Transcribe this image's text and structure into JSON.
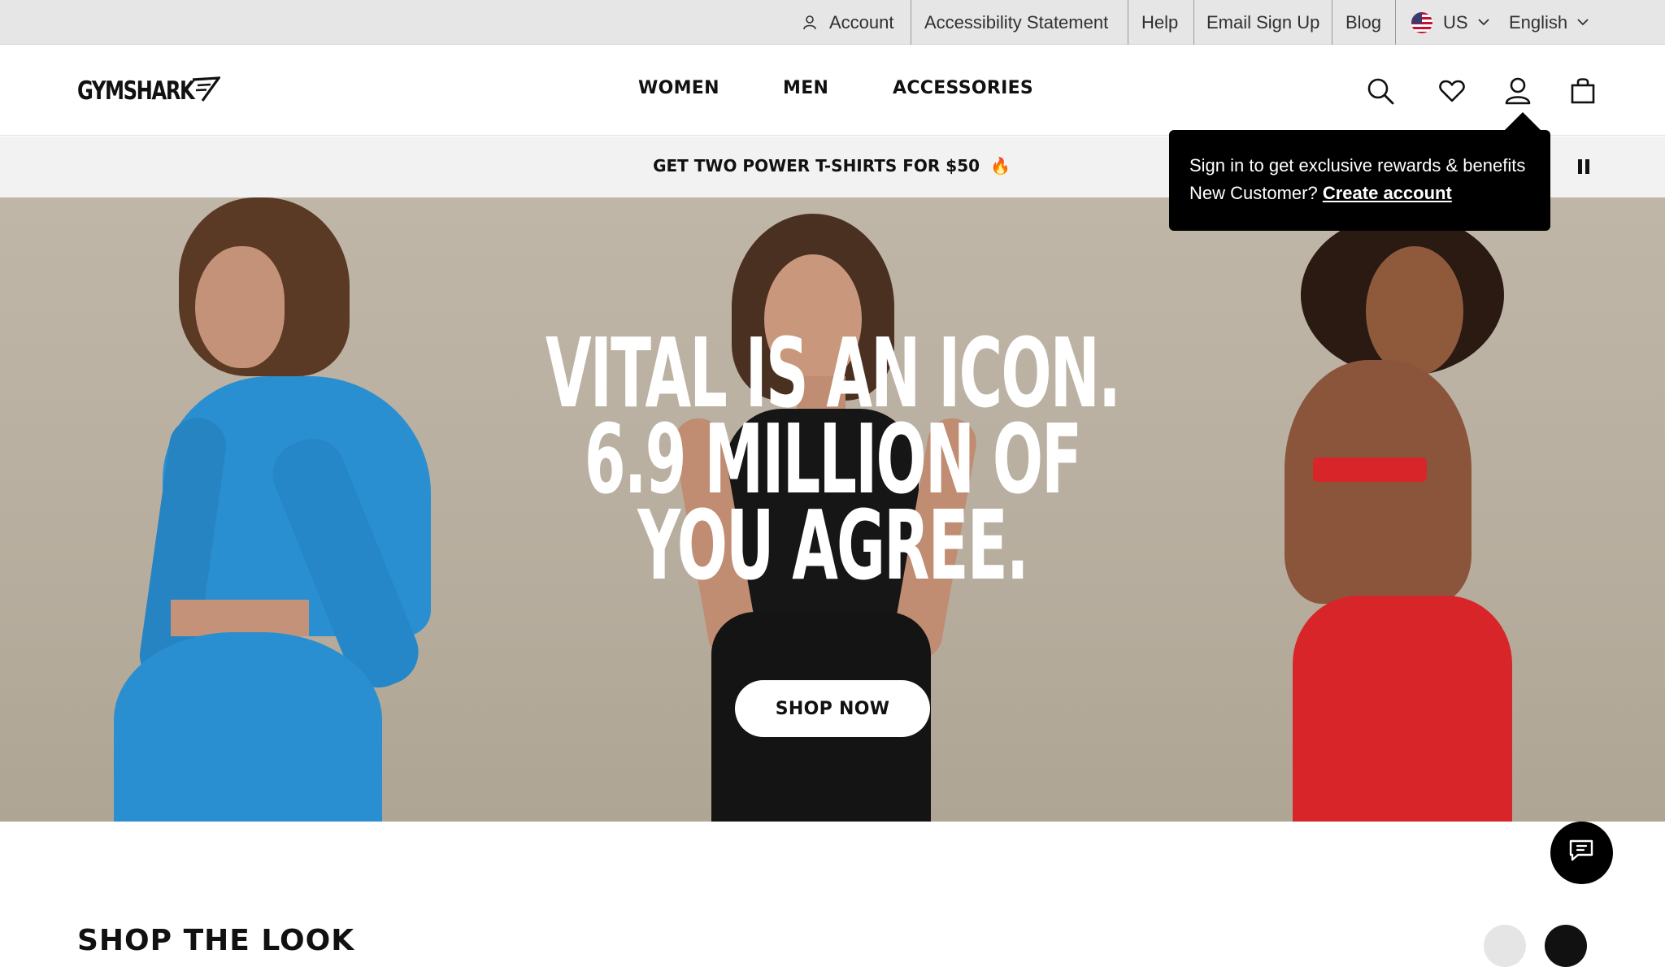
{
  "utility_bar": {
    "account_label": "Account",
    "links": [
      "Accessibility Statement",
      "Help",
      "Email Sign Up",
      "Blog"
    ],
    "region": "US",
    "language": "English"
  },
  "header": {
    "logo_text": "GYMSHARK",
    "nav": [
      "WOMEN",
      "MEN",
      "ACCESSORIES"
    ],
    "icons": [
      "search-icon",
      "heart-icon",
      "account-icon",
      "bag-icon"
    ]
  },
  "promo": {
    "text": "GET TWO POWER T-SHIRTS FOR $50",
    "emoji": "🔥"
  },
  "hero": {
    "title_lines": [
      "VITAL IS AN ICON.",
      "6.9 MILLION OF",
      "YOU AGREE."
    ],
    "cta": "SHOP NOW"
  },
  "tooltip": {
    "line1": "Sign in to get exclusive rewards & benefits",
    "line2_prefix": "New Customer?",
    "line2_link": "Create account"
  },
  "section": {
    "title": "SHOP THE LOOK"
  },
  "colors": {
    "hero_bg": "#bab1a2",
    "blue_outfit": "#2a8fd0",
    "black_outfit": "#161616",
    "red_outfit": "#d8252a",
    "tooltip_bg": "#000000"
  }
}
